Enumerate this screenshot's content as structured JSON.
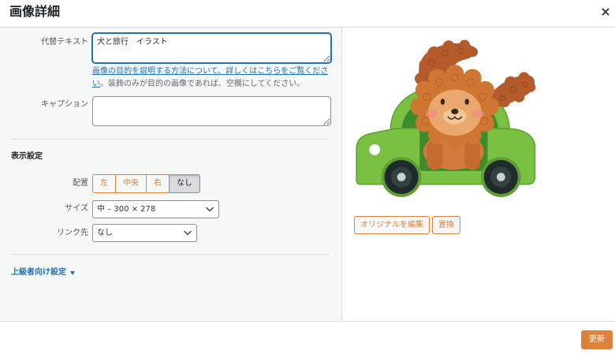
{
  "dialog": {
    "title": "画像詳細",
    "close_icon": "close-icon"
  },
  "attachment_details": {
    "alt_text": {
      "label": "代替テキスト",
      "value": "犬と旅行　イラスト",
      "help_link": "画像の目的を説明する方法について、詳しくはこちらをご覧ください",
      "help_rest": "。装飾のみが目的の画像であれば、空欄にしてください。"
    },
    "caption": {
      "label": "キャプション",
      "value": ""
    }
  },
  "display_settings": {
    "heading": "表示設定",
    "align": {
      "label": "配置",
      "options": [
        "左",
        "中央",
        "右",
        "なし"
      ],
      "selected_index": 3
    },
    "size": {
      "label": "サイズ",
      "value": "中 – 300 × 278",
      "icon": "chevron-down-icon"
    },
    "link_to": {
      "label": "リンク先",
      "value": "なし",
      "icon": "chevron-down-icon"
    }
  },
  "advanced": {
    "label": "上級者向け設定",
    "icon": "arrow-down-icon"
  },
  "image_actions": {
    "edit_original": "オリジナルを編集",
    "replace": "置換"
  },
  "footer": {
    "update": "更新"
  },
  "colors": {
    "accent": "#dd823b",
    "link": "#2271b1",
    "sidebar_bg": "#f6f7f7",
    "border": "#dcdcde"
  }
}
